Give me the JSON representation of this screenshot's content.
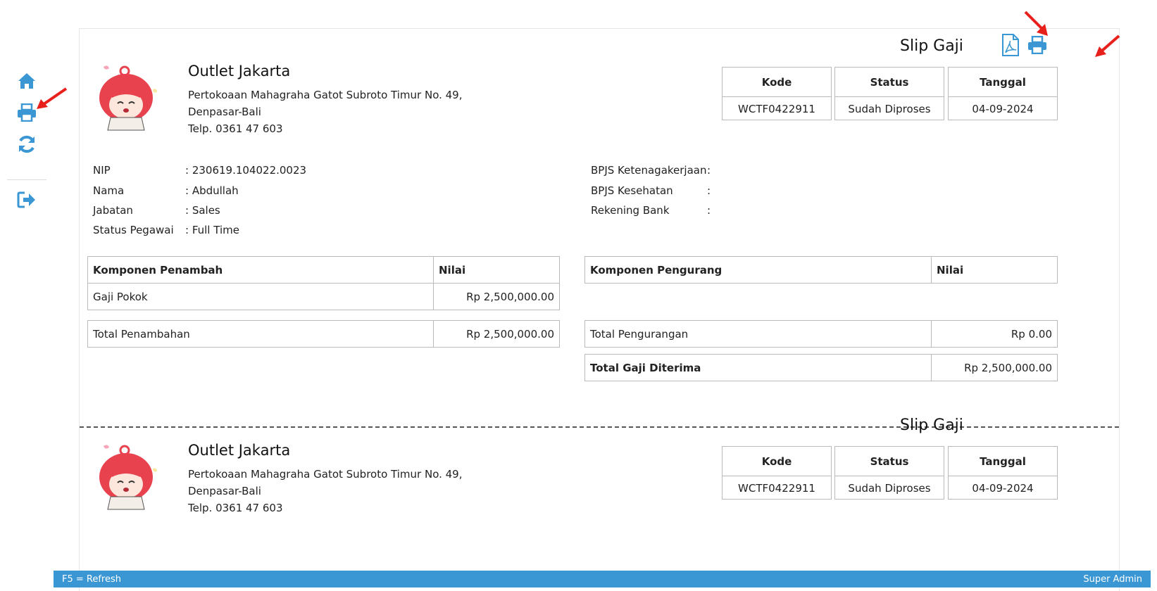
{
  "sidebar": {
    "items": [
      {
        "name": "home-icon"
      },
      {
        "name": "print-icon"
      },
      {
        "name": "refresh-icon"
      },
      {
        "name": "logout-icon"
      }
    ],
    "accent": "#3a97d4"
  },
  "toolbar": {
    "pdf_icon": "pdf-file-icon",
    "print_icon": "printer-icon"
  },
  "slips": [
    {
      "title": "Slip Gaji",
      "outlet": "Outlet Jakarta",
      "address_line1": "Pertokoaan Mahagraha Gatot Subroto Timur No. 49,",
      "address_line2": "Denpasar-Bali",
      "phone": "Telp. 0361 47 603",
      "info": [
        {
          "label": "Kode",
          "value": "WCTF0422911"
        },
        {
          "label": "Status",
          "value": "Sudah Diproses"
        },
        {
          "label": "Tanggal",
          "value": "04-09-2024"
        }
      ]
    },
    {
      "title": "Slip Gaji",
      "outlet": "Outlet Jakarta",
      "address_line1": "Pertokoaan Mahagraha Gatot Subroto Timur No. 49,",
      "address_line2": "Denpasar-Bali",
      "phone": "Telp. 0361 47 603",
      "info": [
        {
          "label": "Kode",
          "value": "WCTF0422911"
        },
        {
          "label": "Status",
          "value": "Sudah Diproses"
        },
        {
          "label": "Tanggal",
          "value": "04-09-2024"
        }
      ]
    }
  ],
  "employee": {
    "left": [
      {
        "label": "NIP",
        "value": ": 230619.104022.0023"
      },
      {
        "label": "Nama",
        "value": ": Abdullah"
      },
      {
        "label": "Jabatan",
        "value": ": Sales"
      },
      {
        "label": "Status Pegawai",
        "value": ": Full Time"
      }
    ],
    "right": [
      {
        "label": "BPJS Ketenagakerjaan",
        "value": ":"
      },
      {
        "label": "BPJS Kesehatan",
        "value": ":"
      },
      {
        "label": "Rekening Bank",
        "value": ":"
      }
    ]
  },
  "additions": {
    "header_component": "Komponen Penambah",
    "header_value": "Nilai",
    "rows": [
      {
        "name": "Gaji Pokok",
        "value": "Rp 2,500,000.00"
      }
    ],
    "total_label": "Total Penambahan",
    "total_value": "Rp 2,500,000.00"
  },
  "deductions": {
    "header_component": "Komponen Pengurang",
    "header_value": "Nilai",
    "total_label": "Total Pengurangan",
    "total_value": "Rp 0.00",
    "net_label": "Total Gaji Diterima",
    "net_value": "Rp 2,500,000.00"
  },
  "statusbar": {
    "left": "F5 = Refresh",
    "right": "Super Admin"
  }
}
